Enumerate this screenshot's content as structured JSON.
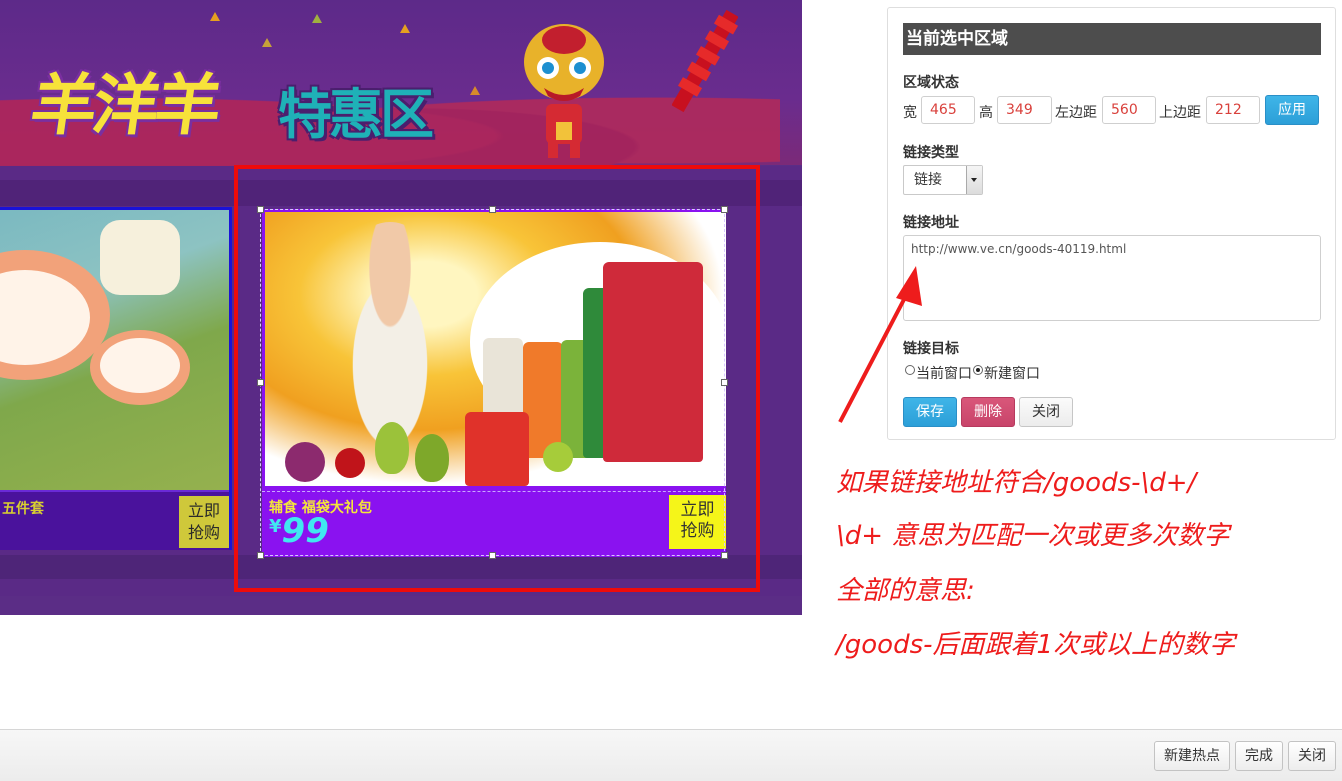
{
  "banner": {
    "title_main": "羊洋羊",
    "title_sub": "特惠区",
    "left_card": {
      "caption": "五件套",
      "buy_line1": "立即",
      "buy_line2": "抢购"
    },
    "selected_card": {
      "caption": "辅食  福袋大礼包",
      "price_currency": "¥",
      "price_value": "99",
      "buy_line1": "立即",
      "buy_line2": "抢购"
    }
  },
  "panel": {
    "title": "当前选中区域",
    "area_state_label": "区域状态",
    "width_label": "宽",
    "width_value": "465",
    "height_label": "高",
    "height_value": "349",
    "left_label": "左边距",
    "left_value": "560",
    "top_label": "上边距",
    "top_value": "212",
    "apply_button": "应用",
    "link_type_label": "链接类型",
    "link_type_value": "链接",
    "link_url_label": "链接地址",
    "link_url_value": "http://www.ve.cn/goods-40119.html",
    "link_target_label": "链接目标",
    "target_current": "当前窗口",
    "target_new": "新建窗口",
    "target_selected": "new",
    "save_button": "保存",
    "delete_button": "删除",
    "close_button": "关闭"
  },
  "annotation": {
    "line1": "如果链接地址符合/goods-\\d+/",
    "line2": "\\d+ 意思为匹配一次或更多次数字",
    "line3": "全部的意思:",
    "line4": "/goods-后面跟着1次或以上的数字",
    "color": "#ee1c1c"
  },
  "bottom_bar": {
    "new_hotspot_button": "新建热点",
    "done_button": "完成",
    "close_button": "关闭"
  },
  "colors": {
    "banner_bg": "#5b2d86",
    "selection_border": "#ee0b0b",
    "primary_button": "#2c9fd8",
    "danger_button": "#c8446a",
    "panel_header": "#4d4d4d"
  }
}
